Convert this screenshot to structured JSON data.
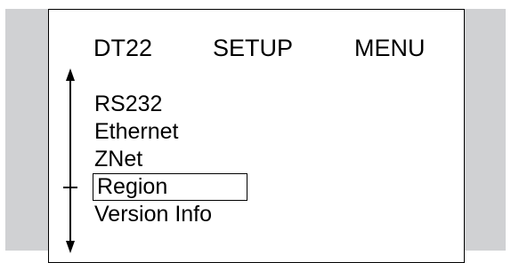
{
  "header": {
    "device": "DT22",
    "screen": "SETUP",
    "menu": "MENU"
  },
  "menu": {
    "items": [
      {
        "label": "RS232",
        "selected": false
      },
      {
        "label": "Ethernet",
        "selected": false
      },
      {
        "label": "ZNet",
        "selected": false
      },
      {
        "label": "Region",
        "selected": true
      },
      {
        "label": "Version Info",
        "selected": false
      }
    ]
  },
  "icons": {
    "scrollbar": "up-down-arrow-icon"
  },
  "colors": {
    "background_band": "#d0d1d3",
    "panel": "#ffffff",
    "text": "#000000"
  }
}
